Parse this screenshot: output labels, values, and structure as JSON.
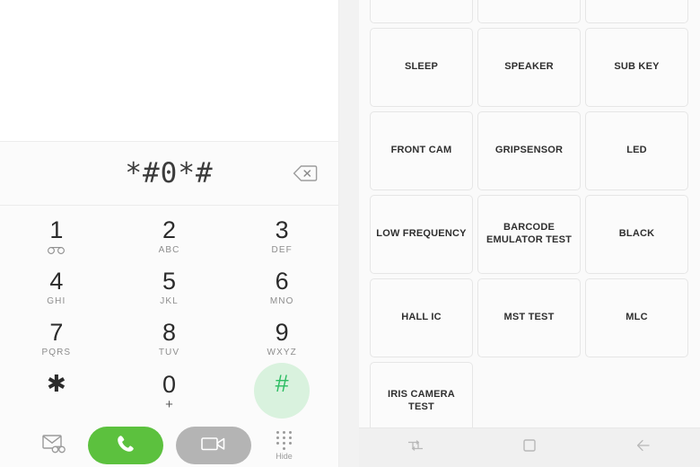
{
  "left_phone": {
    "name": "phone-dialer",
    "dial_display": {
      "number": "*#0*#",
      "backspace_icon": "backspace-icon"
    },
    "keypad": [
      [
        {
          "digit": "1",
          "sub": "",
          "icon": "voicemail-icon",
          "pressed": false
        },
        {
          "digit": "2",
          "sub": "ABC",
          "pressed": false
        },
        {
          "digit": "3",
          "sub": "DEF",
          "pressed": false
        }
      ],
      [
        {
          "digit": "4",
          "sub": "GHI",
          "pressed": false
        },
        {
          "digit": "5",
          "sub": "JKL",
          "pressed": false
        },
        {
          "digit": "6",
          "sub": "MNO",
          "pressed": false
        }
      ],
      [
        {
          "digit": "7",
          "sub": "PQRS",
          "pressed": false
        },
        {
          "digit": "8",
          "sub": "TUV",
          "pressed": false
        },
        {
          "digit": "9",
          "sub": "WXYZ",
          "pressed": false
        }
      ],
      [
        {
          "digit": "✱",
          "sub": "",
          "pressed": false
        },
        {
          "digit": "0",
          "sub": "+",
          "pressed": false
        },
        {
          "digit": "#",
          "sub": "",
          "pressed": true
        }
      ]
    ],
    "action_bar": {
      "message_icon": "video-message-icon",
      "call_button_icon": "phone-handset-icon",
      "video_call_button_icon": "video-camera-icon",
      "hide_keypad_icon": "keypad-dots-icon",
      "hide_label": "Hide"
    }
  },
  "right_phone": {
    "name": "hardware-test-menu",
    "test_buttons": [
      {
        "label": "",
        "partial_top": true
      },
      {
        "label": "",
        "partial_top": true
      },
      {
        "label": "",
        "partial_top": true
      },
      {
        "label": "SLEEP"
      },
      {
        "label": "SPEAKER"
      },
      {
        "label": "SUB KEY"
      },
      {
        "label": "FRONT CAM"
      },
      {
        "label": "GRIPSENSOR"
      },
      {
        "label": "LED"
      },
      {
        "label": "LOW FREQUENCY"
      },
      {
        "label": "BARCODE\nEMULATOR TEST"
      },
      {
        "label": "BLACK"
      },
      {
        "label": "HALL IC"
      },
      {
        "label": "MST TEST"
      },
      {
        "label": "MLC"
      },
      {
        "label": "IRIS CAMERA TEST"
      }
    ],
    "navbar": {
      "recents_icon": "recents-icon",
      "home_icon": "home-square-icon",
      "back_icon": "back-arrow-icon"
    }
  },
  "colors": {
    "call_green": "#5cc13e",
    "video_gray": "#b4b4b4",
    "pressed_key_bg": "#d9f2de",
    "pressed_key_fg": "#2dbd63",
    "dial_text": "#3c3c3c"
  }
}
